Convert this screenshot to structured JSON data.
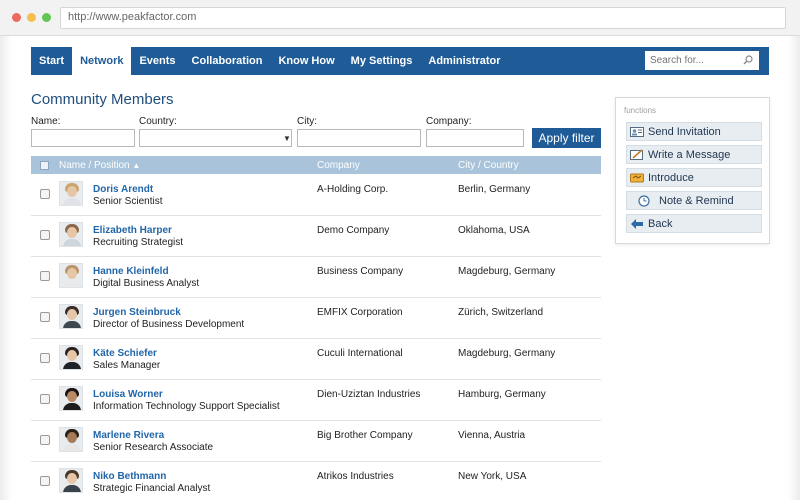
{
  "browser": {
    "url": "http://www.peakfactor.com",
    "dot_colors": [
      "#ec6a5e",
      "#f4bf4f",
      "#61c554"
    ]
  },
  "nav": {
    "items": [
      {
        "label": "Start",
        "active": false
      },
      {
        "label": "Network",
        "active": true
      },
      {
        "label": "Events",
        "active": false
      },
      {
        "label": "Collaboration",
        "active": false
      },
      {
        "label": "Know How",
        "active": false
      },
      {
        "label": "My Settings",
        "active": false
      },
      {
        "label": "Administrator",
        "active": false
      }
    ],
    "search_placeholder": "Search for...",
    "accent": "#1f5b96"
  },
  "page_title": "Community Members",
  "filters": {
    "name_label": "Name:",
    "country_label": "Country:",
    "city_label": "City:",
    "company_label": "Company:",
    "name_value": "",
    "country_value": "",
    "city_value": "",
    "company_value": "",
    "apply_label": "Apply filter"
  },
  "table": {
    "headers": {
      "name": "Name / Position",
      "sort_indicator": "▲",
      "company": "Company",
      "city": "City / Country"
    },
    "rows": [
      {
        "name": "Doris Arendt",
        "position": "Senior Scientist",
        "company": "A-Holding Corp.",
        "city": "Berlin, Germany"
      },
      {
        "name": "Elizabeth Harper",
        "position": "Recruiting Strategist",
        "company": "Demo Company",
        "city": "Oklahoma, USA"
      },
      {
        "name": "Hanne Kleinfeld",
        "position": "Digital Business Analyst",
        "company": "Business Company",
        "city": "Magdeburg, Germany"
      },
      {
        "name": "Jurgen Steinbruck",
        "position": "Director of Business Development",
        "company": "EMFIX Corporation",
        "city": "Zürich, Switzerland"
      },
      {
        "name": "Käte Schiefer",
        "position": "Sales Manager",
        "company": "Cuculi International",
        "city": "Magdeburg, Germany"
      },
      {
        "name": "Louisa Worner",
        "position": "Information Technology Support Specialist",
        "company": "Dien-Uziztan Industries",
        "city": "Hamburg, Germany"
      },
      {
        "name": "Marlene Rivera",
        "position": "Senior Research Associate",
        "company": "Big Brother Company",
        "city": "Vienna, Austria"
      },
      {
        "name": "Niko Bethmann",
        "position": "Strategic Financial Analyst",
        "company": "Atrikos Industries",
        "city": "New York, USA"
      }
    ]
  },
  "functions": {
    "title": "functions",
    "buttons": [
      {
        "label": "Send Invitation",
        "icon": "invitation-icon"
      },
      {
        "label": "Write a Message",
        "icon": "message-icon"
      },
      {
        "label": "Introduce",
        "icon": "introduce-icon"
      },
      {
        "label": "Note & Remind",
        "icon": "clock-icon"
      },
      {
        "label": "Back",
        "icon": "back-arrow-icon"
      }
    ]
  }
}
